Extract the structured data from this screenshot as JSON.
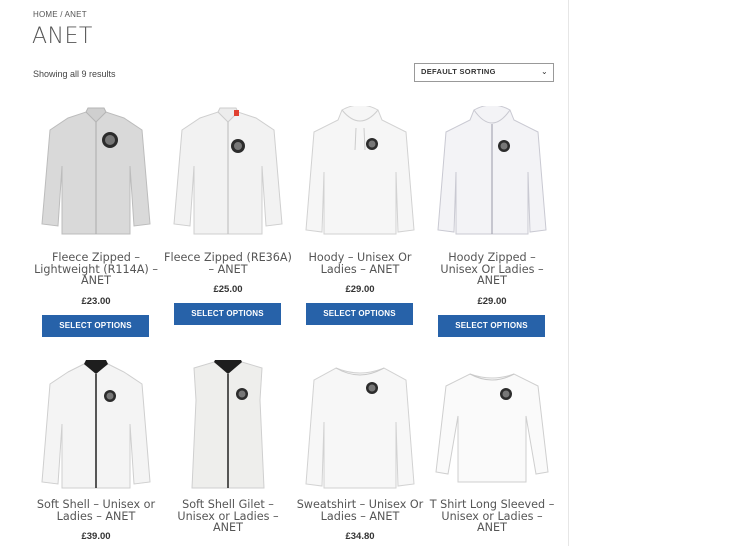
{
  "breadcrumb": {
    "home": "HOME",
    "separator": " / ",
    "current": "ANET"
  },
  "page_title": "ANET",
  "result_count": "Showing all 9 results",
  "sorting": {
    "selected": "DEFAULT SORTING"
  },
  "products": [
    {
      "title": "Fleece Zipped – Lightweight (R114A) – ANET",
      "price": "£23.00",
      "button": "SELECT OPTIONS",
      "image": "fleece-zip-light-icon"
    },
    {
      "title": "Fleece Zipped (RE36A) – ANET",
      "price": "£25.00",
      "button": "SELECT OPTIONS",
      "image": "fleece-zip-icon"
    },
    {
      "title": "Hoody – Unisex Or Ladies – ANET",
      "price": "£29.00",
      "button": "SELECT OPTIONS",
      "image": "hoody-icon"
    },
    {
      "title": "Hoody Zipped – Unisex Or Ladies – ANET",
      "price": "£29.00",
      "button": "SELECT OPTIONS",
      "image": "hoody-zip-icon"
    },
    {
      "title": "Soft Shell – Unisex or Ladies – ANET",
      "price": "£39.00",
      "button": "",
      "image": "softshell-icon"
    },
    {
      "title": "Soft Shell Gilet – Unisex or Ladies – ANET",
      "price": "",
      "button": "",
      "image": "gilet-icon"
    },
    {
      "title": "Sweatshirt – Unisex Or Ladies – ANET",
      "price": "£34.80",
      "button": "",
      "image": "sweatshirt-icon"
    },
    {
      "title": "T Shirt Long Sleeved – Unisex or Ladies – ANET",
      "price": "",
      "button": "",
      "image": "longsleeve-icon"
    }
  ]
}
